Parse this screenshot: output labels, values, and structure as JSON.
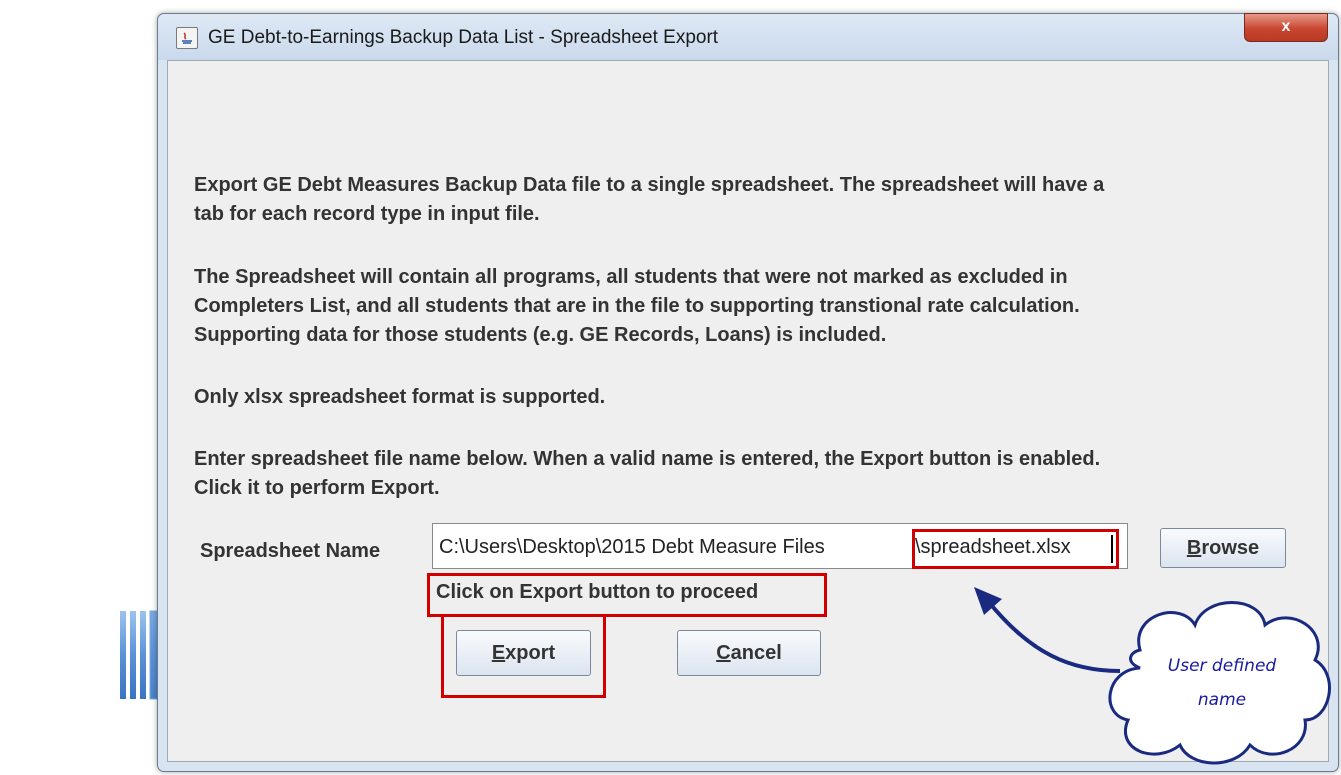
{
  "window": {
    "title": "GE Debt-to-Earnings Backup Data List  - Spreadsheet Export",
    "close_glyph": "x",
    "icon": "java-app-icon"
  },
  "body": {
    "para1_line1": "Export GE Debt Measures Backup Data file to a single spreadsheet. The spreadsheet will have a",
    "para1_line2": "tab for each record type in input file.",
    "para2_line1": "The Spreadsheet will contain all programs, all students that were not marked as excluded in",
    "para2_line2": "Completers List, and all students that are in the file to supporting transtional rate calculation.",
    "para2_line3": "Supporting data for those students (e.g. GE Records, Loans) is included.",
    "para3": "Only xlsx spreadsheet format is supported.",
    "para4_line1": "Enter spreadsheet file name below. When a valid name is entered, the Export button is enabled.",
    "para4_line2": "Click it to perform Export."
  },
  "form": {
    "label": "Spreadsheet Name",
    "value": "C:\\Users\\Desktop\\2015 Debt Measure Files\\spreadsheet.xlsx",
    "value_path": "C:\\Users\\Desktop\\2015 Debt Measure Files",
    "value_file": "\\spreadsheet.xlsx",
    "browse_label_mnemonic": "B",
    "browse_label_rest": "rowse"
  },
  "actions": {
    "export_mnemonic": "E",
    "export_rest": "xport",
    "cancel_mnemonic": "C",
    "cancel_rest": "ancel"
  },
  "annotations": {
    "hint": "Click on Export button to proceed",
    "cloud_line1": "User defined",
    "cloud_line2": "name",
    "highlight_color": "#d00000",
    "arrow_color": "#4f81c7"
  }
}
